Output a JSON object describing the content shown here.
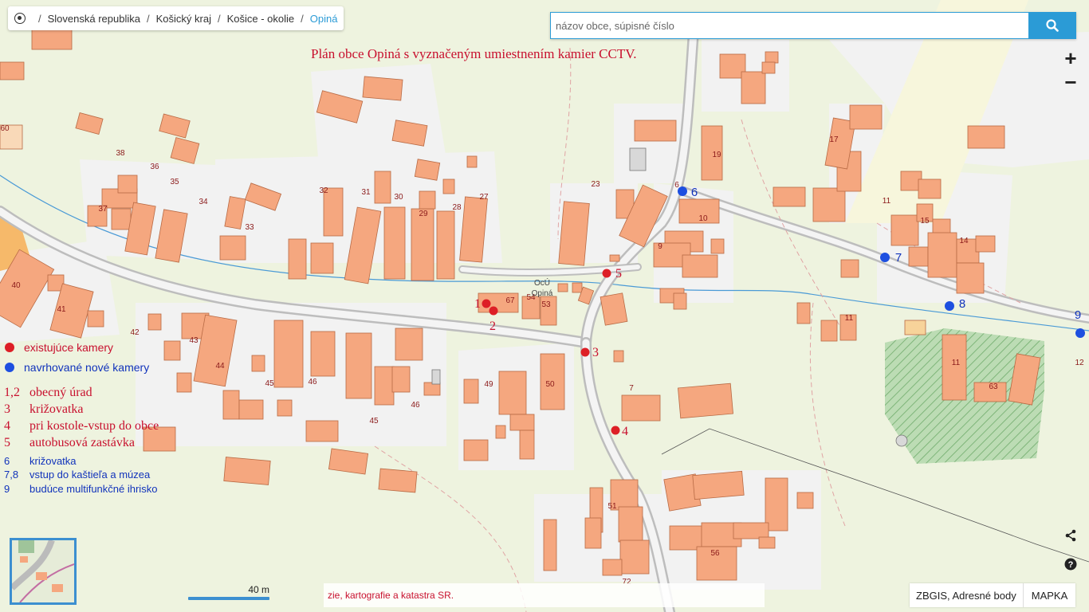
{
  "breadcrumb": {
    "items": [
      "Slovenská republika",
      "Košický kraj",
      "Košice - okolie"
    ],
    "current": "Opiná",
    "separator": "/"
  },
  "search": {
    "value": "",
    "placeholder": "názov obce, súpisné číslo"
  },
  "zoom": {
    "in_label": "+",
    "out_label": "−"
  },
  "map_title": "Plán obce Opiná s vyznačeným umiestnením kamier CCTV.",
  "legend": {
    "existing": "existujúce kamery",
    "proposed": "navrhované nové kamery",
    "entries": [
      {
        "num": "1,2",
        "text": "obecný úrad"
      },
      {
        "num": "3",
        "text": "križovatka"
      },
      {
        "num": "4",
        "text": "pri kostole-vstup do obce"
      },
      {
        "num": "5",
        "text": "autobusová zastávka"
      },
      {
        "num": "6",
        "text": "križovatka"
      },
      {
        "num": "7,8",
        "text": "vstup do kaštieľa a múzea"
      },
      {
        "num": "9",
        "text": "budúce multifunkčné ihrisko"
      }
    ]
  },
  "cameras_existing": [
    "1",
    "2",
    "3",
    "4",
    "5"
  ],
  "cameras_proposed": [
    "6",
    "7",
    "8",
    "9"
  ],
  "house_numbers": [
    "60",
    "38",
    "36",
    "35",
    "34",
    "37",
    "33",
    "32",
    "31",
    "30",
    "29",
    "28",
    "27",
    "23",
    "19",
    "17",
    "11",
    "15",
    "14",
    "10",
    "9",
    "6",
    "40",
    "41",
    "42",
    "43",
    "44",
    "45",
    "46",
    "45",
    "46",
    "49",
    "50",
    "54",
    "53",
    "67",
    "7",
    "51",
    "56",
    "72",
    "11",
    "11",
    "63",
    "12"
  ],
  "place_label": {
    "line1": "OcÚ",
    "line2": "Opiná"
  },
  "scale": {
    "label": "40 m"
  },
  "attribution": "zie, kartografie a katastra SR.",
  "layers": {
    "active": "ZBGIS, Adresné body",
    "basemap": "MAPKA"
  },
  "colors": {
    "background": "#eef3df",
    "building": "#f5a77f",
    "road": "#c9c9c9",
    "camera_existing": "#dd1f26",
    "camera_proposed": "#1d4fe0",
    "accent": "#2b9bd6",
    "park_hatch": "#6aa96a"
  },
  "icons": [
    "home-icon",
    "search-icon",
    "share-icon",
    "help-icon"
  ]
}
